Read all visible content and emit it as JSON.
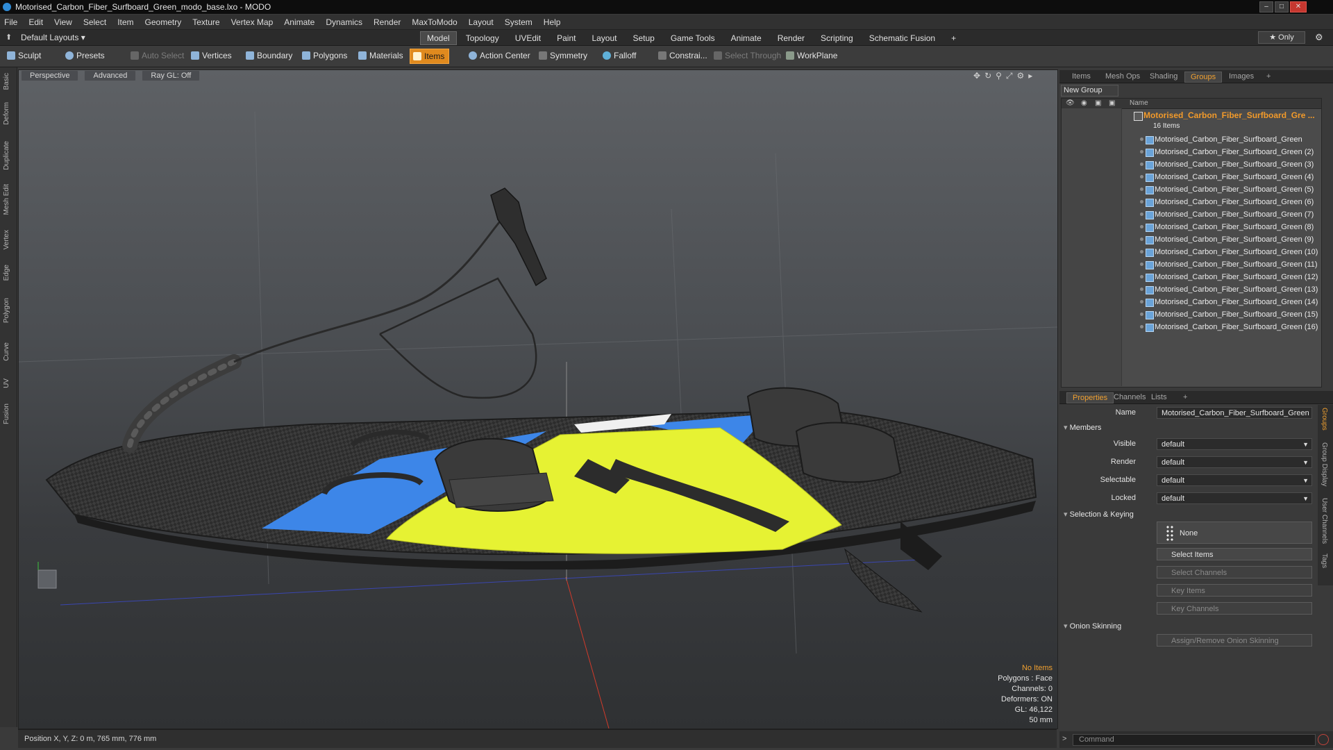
{
  "window": {
    "title": "Motorised_Carbon_Fiber_Surfboard_Green_modo_base.lxo - MODO"
  },
  "menu": [
    "File",
    "Edit",
    "View",
    "Select",
    "Item",
    "Geometry",
    "Texture",
    "Vertex Map",
    "Animate",
    "Dynamics",
    "Render",
    "MaxToModo",
    "Layout",
    "System",
    "Help"
  ],
  "layout_bar": {
    "layouts_label": "Default Layouts ▾",
    "tabs": [
      "Model",
      "Topology",
      "UVEdit",
      "Paint",
      "Layout",
      "Setup",
      "Game Tools",
      "Animate",
      "Render",
      "Scripting",
      "Schematic Fusion"
    ],
    "active_tab": "Model",
    "add": "+",
    "only_label": "★ Only"
  },
  "toolbar": {
    "sculpt": "Sculpt",
    "presets": "Presets",
    "auto_select": "Auto Select",
    "vertices": "Vertices",
    "boundary": "Boundary",
    "polygons": "Polygons",
    "materials": "Materials",
    "items": "Items",
    "action_center": "Action Center",
    "symmetry": "Symmetry",
    "falloff": "Falloff",
    "constraints": "Constrai...",
    "select_through": "Select Through",
    "workplane": "WorkPlane"
  },
  "left_tabs": [
    "Basic",
    "Deform",
    "Duplicate",
    "Mesh Edit",
    "Vertex",
    "Edge",
    "Polygon",
    "Curve",
    "UV",
    "Fusion"
  ],
  "viewport": {
    "perspective": "Perspective",
    "advanced": "Advanced",
    "raygl": "Ray GL: Off",
    "hud": {
      "items": "No Items",
      "polygons": "Polygons : Face",
      "channels": "Channels: 0",
      "deformers": "Deformers: ON",
      "gl": "GL: 46,122",
      "scale": "50 mm"
    },
    "position": "Position X, Y, Z:  0 m, 765 mm, 776 mm"
  },
  "items_panel": {
    "tabs": [
      "Items",
      "Mesh Ops",
      "Shading",
      "Groups",
      "Images"
    ],
    "active_tab": "Groups",
    "add": "+",
    "new_group": "New Group",
    "name_header": "Name",
    "group_name": "Motorised_Carbon_Fiber_Surfboard_Gre ...",
    "group_count": "16 Items",
    "children": [
      "Motorised_Carbon_Fiber_Surfboard_Green",
      "Motorised_Carbon_Fiber_Surfboard_Green (2)",
      "Motorised_Carbon_Fiber_Surfboard_Green (3)",
      "Motorised_Carbon_Fiber_Surfboard_Green (4)",
      "Motorised_Carbon_Fiber_Surfboard_Green (5)",
      "Motorised_Carbon_Fiber_Surfboard_Green (6)",
      "Motorised_Carbon_Fiber_Surfboard_Green (7)",
      "Motorised_Carbon_Fiber_Surfboard_Green (8)",
      "Motorised_Carbon_Fiber_Surfboard_Green (9)",
      "Motorised_Carbon_Fiber_Surfboard_Green (10)",
      "Motorised_Carbon_Fiber_Surfboard_Green (11)",
      "Motorised_Carbon_Fiber_Surfboard_Green (12)",
      "Motorised_Carbon_Fiber_Surfboard_Green (13)",
      "Motorised_Carbon_Fiber_Surfboard_Green (14)",
      "Motorised_Carbon_Fiber_Surfboard_Green (15)",
      "Motorised_Carbon_Fiber_Surfboard_Green (16)"
    ]
  },
  "properties": {
    "tabs": [
      "Properties",
      "Channels",
      "Lists"
    ],
    "active_tab": "Properties",
    "add": "+",
    "name_label": "Name",
    "name_value": "Motorised_Carbon_Fiber_Surfboard_Green (",
    "members": "Members",
    "visible_label": "Visible",
    "visible_value": "default",
    "render_label": "Render",
    "render_value": "default",
    "selectable_label": "Selectable",
    "selectable_value": "default",
    "locked_label": "Locked",
    "locked_value": "default",
    "selection_keying": "Selection & Keying",
    "none_btn": "None",
    "select_items": "Select Items",
    "select_channels": "Select Channels",
    "key_items": "Key Items",
    "key_channels": "Key Channels",
    "onion": "Onion Skinning",
    "onion_btn": "Assign/Remove Onion Skinning",
    "right_tabs": [
      "Groups",
      "Group Display",
      "User Channels",
      "Tags"
    ]
  },
  "command": {
    "placeholder": "Command"
  },
  "colors": {
    "accent": "#f0a030",
    "board_yellow": "#e6f233",
    "board_blue": "#3d86e8",
    "carbon": "#2a2a2a"
  }
}
